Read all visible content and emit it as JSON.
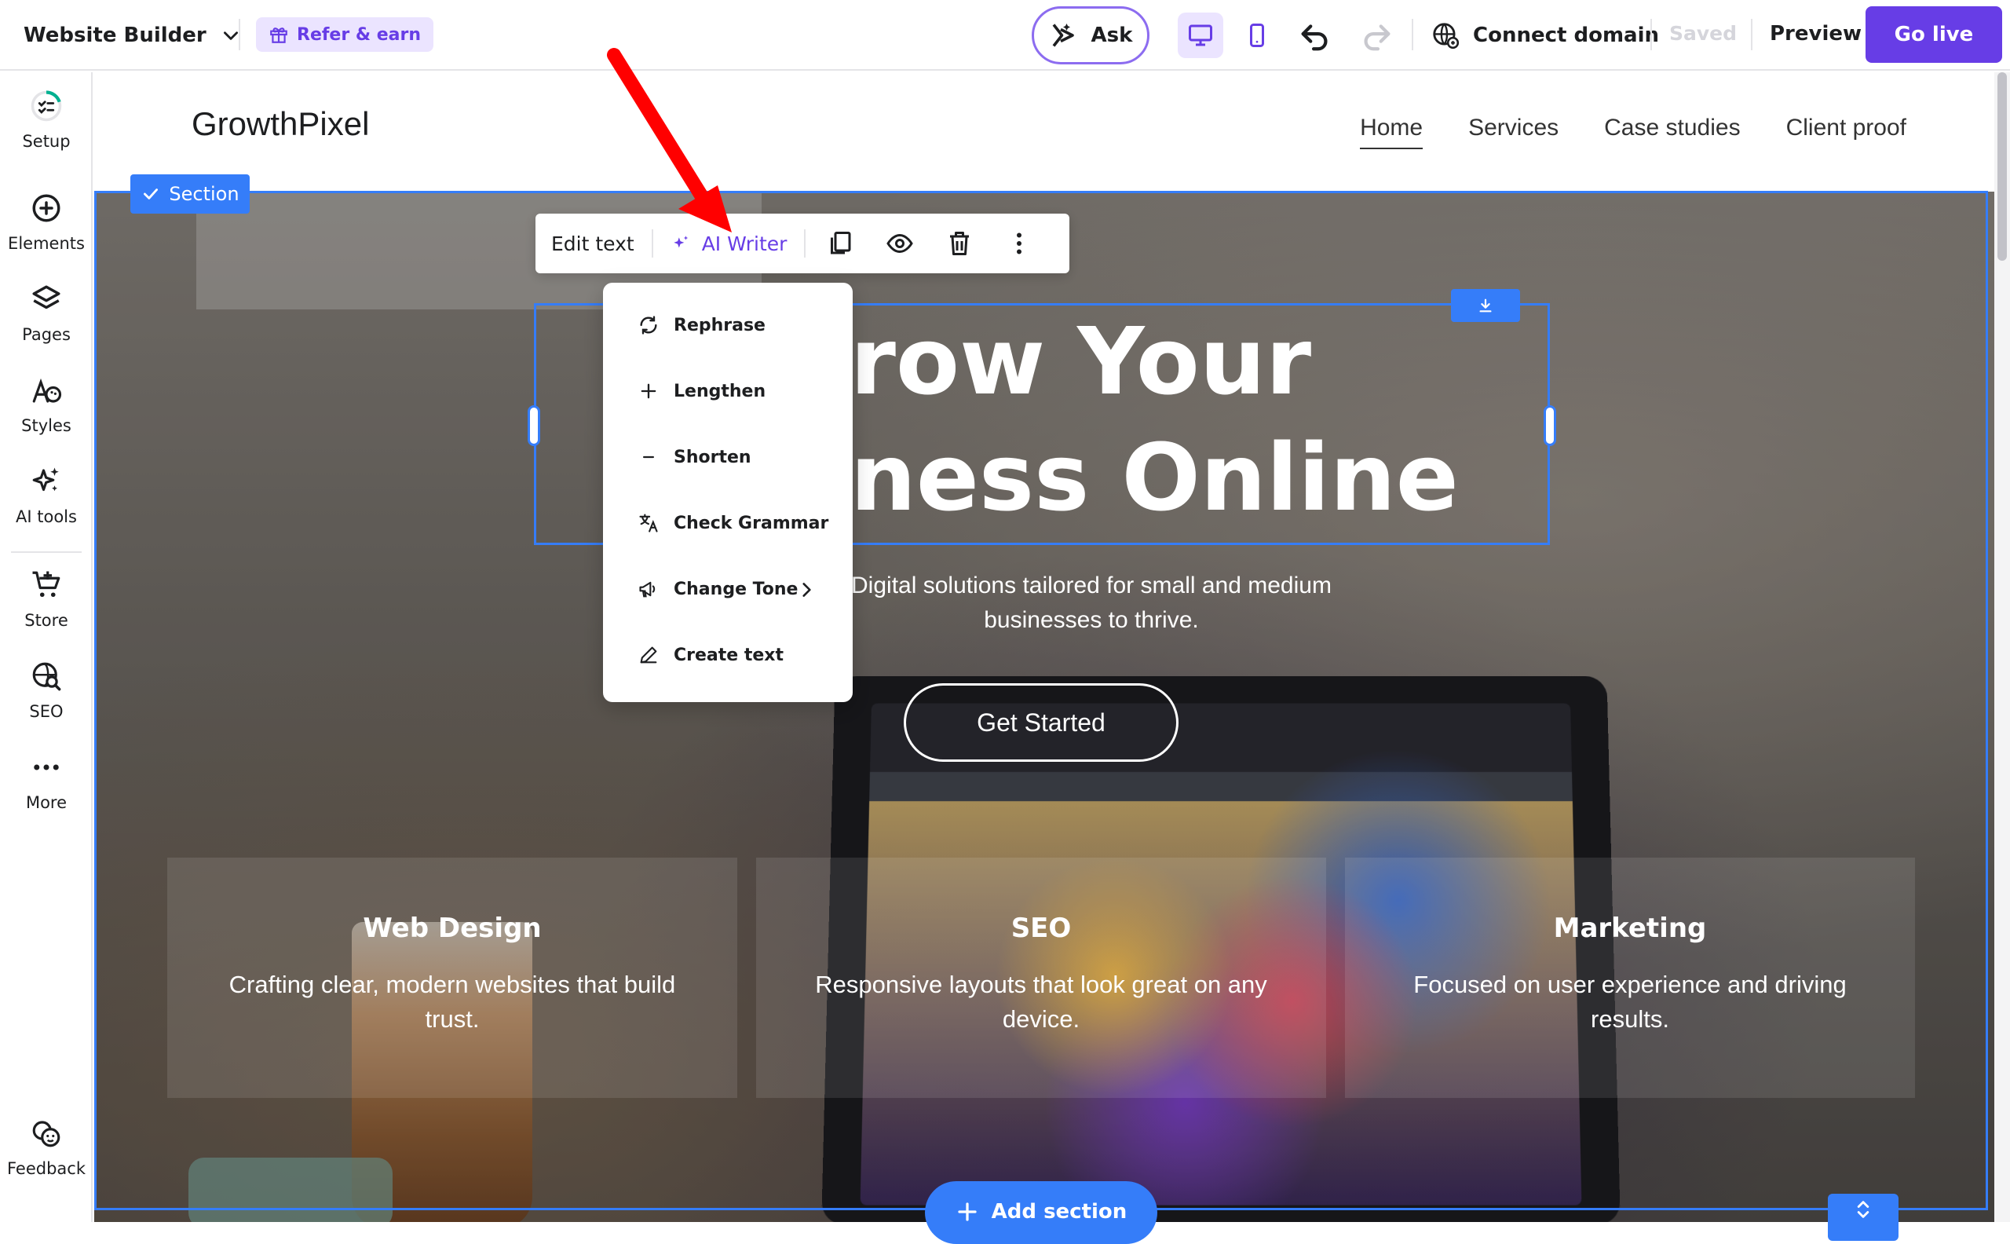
{
  "toolbar": {
    "app_name": "Website Builder",
    "refer_label": "Refer & earn",
    "ask_label": "Ask",
    "connect_domain_label": "Connect domain",
    "saved_label": "Saved",
    "preview_label": "Preview",
    "go_live_label": "Go live"
  },
  "sidebar": {
    "items": [
      {
        "label": "Setup",
        "icon": "setup-checklist-icon"
      },
      {
        "label": "Elements",
        "icon": "plus-circle-icon"
      },
      {
        "label": "Pages",
        "icon": "layers-icon"
      },
      {
        "label": "Styles",
        "icon": "styles-palette-icon"
      },
      {
        "label": "AI tools",
        "icon": "sparkles-icon"
      },
      {
        "label": "Store",
        "icon": "cart-icon"
      },
      {
        "label": "SEO",
        "icon": "seo-globe-icon"
      },
      {
        "label": "More",
        "icon": "more-dots-icon"
      }
    ],
    "feedback_label": "Feedback"
  },
  "site": {
    "logo": "GrowthPixel",
    "nav": [
      "Home",
      "Services",
      "Case studies",
      "Client proof"
    ],
    "section_tag": "Section",
    "hero_title": "Grow Your Business Online",
    "hero_subtitle": "Digital solutions tailored for small and medium businesses to thrive.",
    "cta_label": "Get Started",
    "cards": [
      {
        "title": "Web Design",
        "text": "Crafting clear, modern websites that build trust."
      },
      {
        "title": "SEO",
        "text": "Responsive layouts that look great on any device."
      },
      {
        "title": "Marketing",
        "text": "Focused on user experience and driving results."
      }
    ]
  },
  "text_toolbar": {
    "edit_text_label": "Edit text",
    "ai_writer_label": "AI Writer"
  },
  "ai_menu": {
    "items": [
      "Rephrase",
      "Lengthen",
      "Shorten",
      "Check Grammar",
      "Change Tone",
      "Create text"
    ]
  },
  "bottom": {
    "add_section_label": "Add section"
  },
  "colors": {
    "brand_purple": "#673de6",
    "selection_blue": "#357df9",
    "annotation_red": "#ff0000"
  }
}
